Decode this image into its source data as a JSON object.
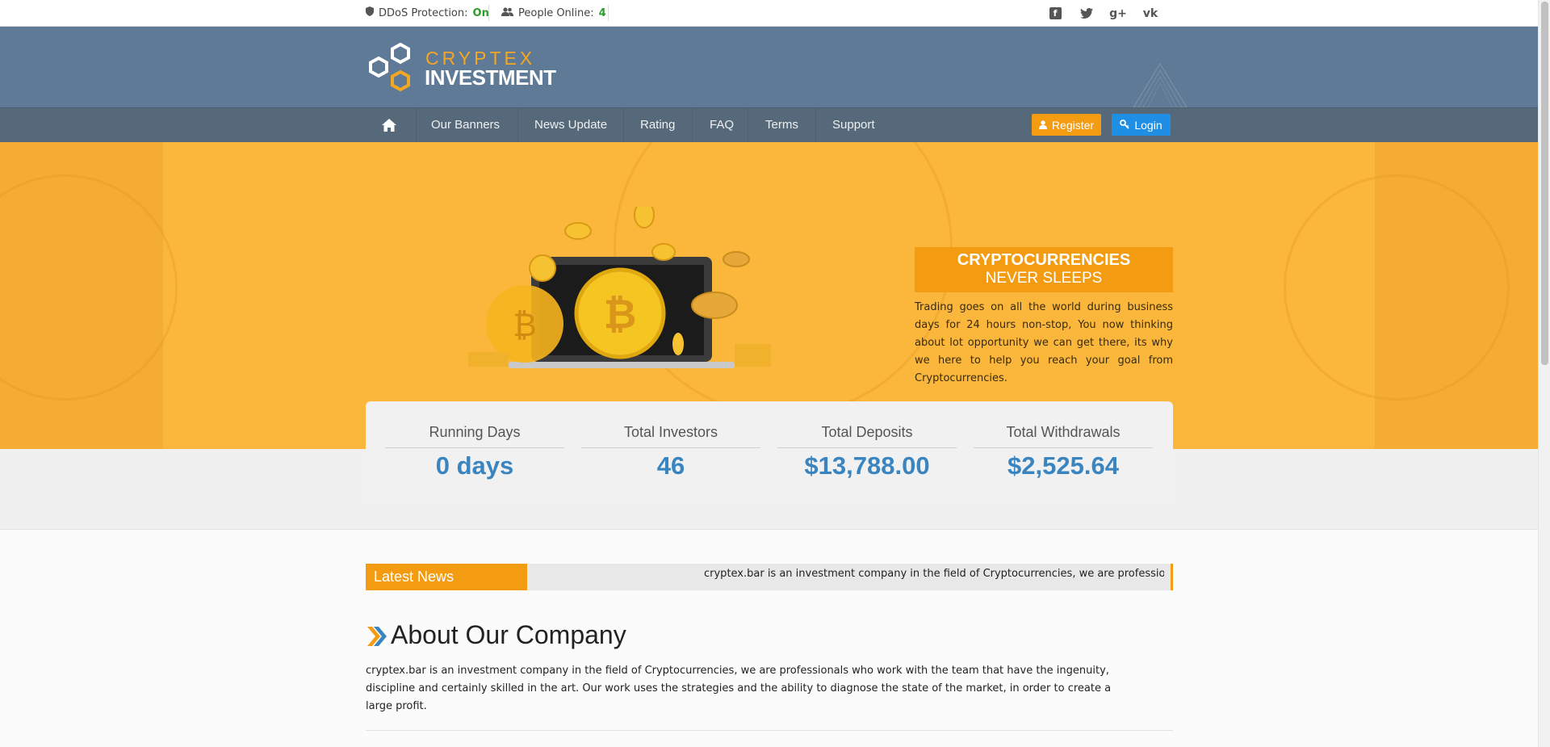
{
  "topbar": {
    "ddos_label": "DDoS Protection:",
    "ddos_value": "On",
    "online_label": "People Online:",
    "online_value": "4",
    "social": [
      "facebook-icon",
      "twitter-icon",
      "google-plus-icon",
      "vk-icon"
    ]
  },
  "logo": {
    "line1": "CRYPTEX",
    "line2": "INVESTMENT"
  },
  "nav": {
    "home_icon": "home-icon",
    "items": [
      "Our Banners",
      "News Update",
      "Rating",
      "FAQ",
      "Terms",
      "Support"
    ],
    "register": "Register",
    "login": "Login"
  },
  "hero": {
    "title_line1": "CRYPTOCURRENCIES",
    "title_line2": "NEVER SLEEPS",
    "text": "Trading goes on all the world during business days for 24 hours non-stop, You now thinking about lot opportunity we can get there, its why we here to help you reach your goal from Cryptocurrencies."
  },
  "stats": [
    {
      "label": "Running Days",
      "value": "0 days"
    },
    {
      "label": "Total Investors",
      "value": "46"
    },
    {
      "label": "Total Deposits",
      "value": "$13,788.00"
    },
    {
      "label": "Total Withdrawals",
      "value": "$2,525.64"
    }
  ],
  "news": {
    "label": "Latest News",
    "ticker": "cryptex.bar is an investment company in the field of Cryptocurrencies, we are professionals who work with the team that have the ingenuity"
  },
  "about": {
    "title": "About Our Company",
    "text": "cryptex.bar is an investment company in the field of Cryptocurrencies, we are professionals who work with the team that have the ingenuity, discipline and certainly skilled in the art. Our work uses the strategies and the ability to diagnose the state of the market, in order to create a large profit."
  },
  "colors": {
    "accent": "#f39c12",
    "header": "#5f7a96",
    "nav": "#55697a",
    "login": "#1f8fe5",
    "stat_value": "#3a85c0"
  }
}
